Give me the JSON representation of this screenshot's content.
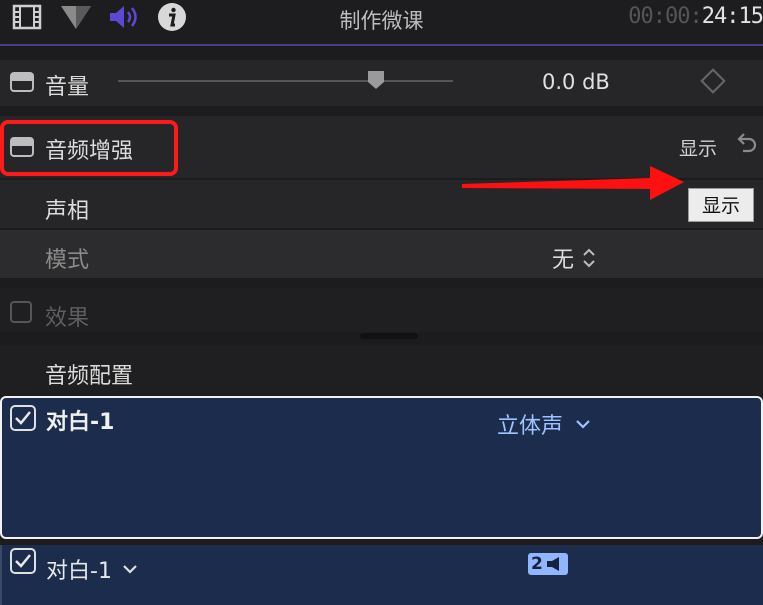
{
  "toolbar": {
    "title": "制作微课",
    "timecode_dim": "00:00:",
    "timecode_bright": "24:15",
    "icons": [
      "film-icon",
      "video-inspector-icon",
      "speaker-icon",
      "info-icon"
    ],
    "accent": "#4a3c82"
  },
  "volume": {
    "label": "音量",
    "value": "0.0 dB",
    "level_db": 0.0
  },
  "enhancement": {
    "label": "音频增强",
    "show_label": "显示",
    "highlight_color": "#ff1a1a"
  },
  "pan": {
    "label": "声相",
    "mode_label": "模式",
    "mode_value": "无"
  },
  "tooltip": {
    "text": "显示"
  },
  "effects": {
    "label": "效果"
  },
  "config": {
    "label": "音频配置",
    "items": [
      {
        "name": "对白-1",
        "channel": "立体声",
        "checked": true
      },
      {
        "name": "对白-1",
        "badge": "2",
        "checked": true
      }
    ]
  }
}
